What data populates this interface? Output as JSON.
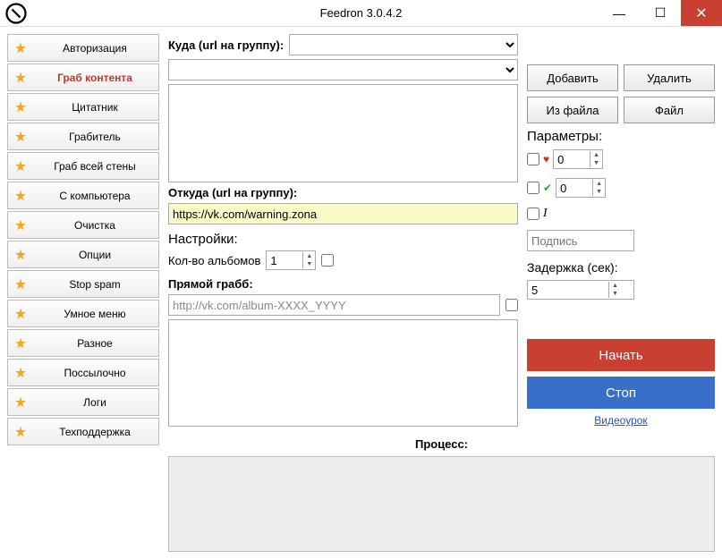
{
  "window": {
    "title": "Feedron 3.0.4.2"
  },
  "sidebar": {
    "items": [
      {
        "label": "Авторизация"
      },
      {
        "label": "Граб контента",
        "active": true
      },
      {
        "label": "Цитатник"
      },
      {
        "label": "Грабитель"
      },
      {
        "label": "Граб всей стены"
      },
      {
        "label": "С компьютера"
      },
      {
        "label": "Очистка"
      },
      {
        "label": "Опции"
      },
      {
        "label": "Stop spam"
      },
      {
        "label": "Умное меню"
      },
      {
        "label": "Разное"
      },
      {
        "label": "Поссылочно"
      },
      {
        "label": "Логи"
      },
      {
        "label": "Техподдержка"
      }
    ]
  },
  "main": {
    "kuda_label": "Куда (url на группу):",
    "otkuda_label": "Откуда (url на группу):",
    "otkuda_value": "https://vk.com/warning.zona",
    "settings_label": "Настройки:",
    "albums_label": "Кол-во альбомов",
    "albums_value": "1",
    "direct_grab_label": "Прямой грабб:",
    "direct_grab_value": "http://vk.com/album-XXXX_YYYY",
    "process_label": "Процесс:"
  },
  "right": {
    "btn_add": "Добавить",
    "btn_delete": "Удалить",
    "btn_fromfile": "Из файла",
    "btn_file": "Файл",
    "params_label": "Параметры:",
    "heart_value": "0",
    "check_value": "0",
    "signature_placeholder": "Подпись",
    "delay_label": "Задержка (сек):",
    "delay_value": "5",
    "btn_start": "Начать",
    "btn_stop": "Стоп",
    "link_tutorial": "Видеоурок"
  }
}
